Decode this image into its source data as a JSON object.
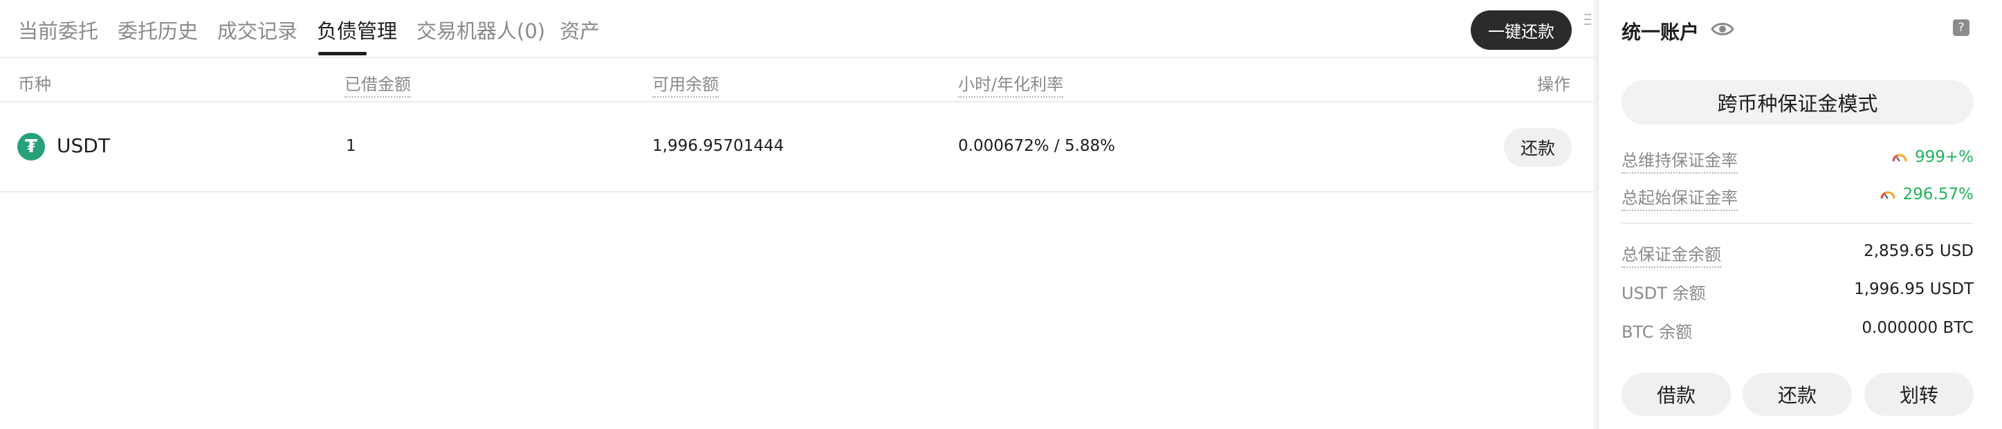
{
  "tabs": [
    {
      "label": "当前委托"
    },
    {
      "label": "委托历史"
    },
    {
      "label": "成交记录"
    },
    {
      "label": "负债管理"
    },
    {
      "label": "交易机器人(0)"
    },
    {
      "label": "资产"
    }
  ],
  "active_tab": "负债管理",
  "repay_all_label": "一键还款",
  "table": {
    "headers": [
      "币种",
      "已借金额",
      "可用余额",
      "小时/年化利率",
      "操作"
    ],
    "rows": [
      {
        "coin": "USDT",
        "coin_icon": "tether-icon",
        "borrowed": "1",
        "available": "1,996.95701444",
        "rate": "0.000672% / 5.88%",
        "action": "还款"
      }
    ]
  },
  "account": {
    "title": "统一账户",
    "mode": "跨币种保证金模式",
    "maintenance_margin_label": "总维持保证金率",
    "maintenance_margin_value": "999+%",
    "initial_margin_label": "总起始保证金率",
    "initial_margin_value": "296.57%",
    "balances": [
      {
        "label": "总保证金余额",
        "value": "2,859.65 USD"
      },
      {
        "label": "USDT 余额",
        "value": "1,996.95 USDT"
      },
      {
        "label": "BTC 余额",
        "value": "0.000000 BTC"
      }
    ],
    "buttons": {
      "borrow": "借款",
      "repay": "还款",
      "transfer": "划转"
    }
  },
  "colors": {
    "accent_dark": "#2b2b2b",
    "positive": "#20b35a",
    "tether": "#26a17b"
  }
}
